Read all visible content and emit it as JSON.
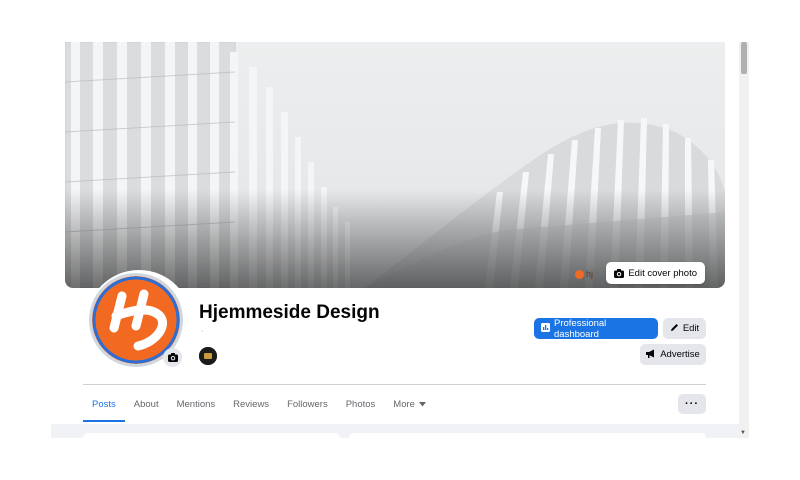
{
  "page": {
    "name": "Hjemmeside Design",
    "subtitle_dot": "·"
  },
  "cover": {
    "edit_label": "Edit cover photo",
    "edit_icon": "camera-icon",
    "watermark_text": "hj"
  },
  "actions": {
    "professional_dashboard": "Professional dashboard",
    "edit": "Edit",
    "advertise": "Advertise"
  },
  "tabs": [
    {
      "label": "Posts",
      "active": true
    },
    {
      "label": "About"
    },
    {
      "label": "Mentions"
    },
    {
      "label": "Reviews"
    },
    {
      "label": "Followers"
    },
    {
      "label": "Photos"
    },
    {
      "label": "More"
    }
  ],
  "more_menu": "···",
  "colors": {
    "accent": "#1b74e4",
    "logo_orange": "#f26a21",
    "logo_ring": "#2b6fd6"
  }
}
